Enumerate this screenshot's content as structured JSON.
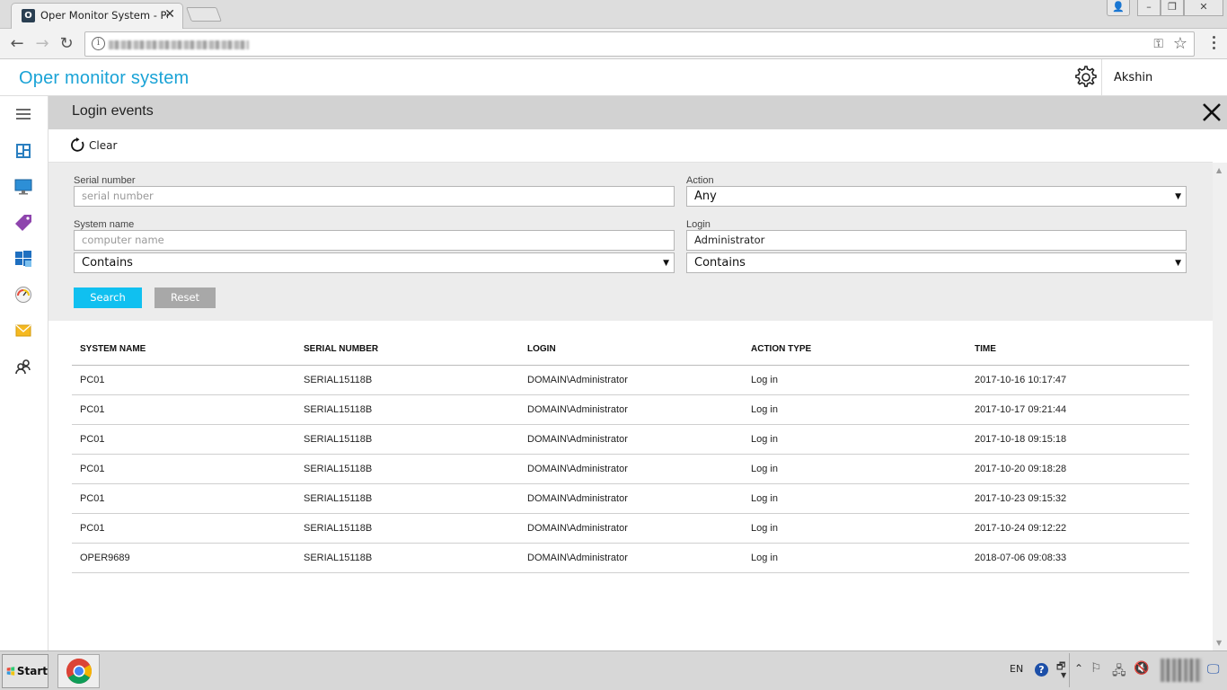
{
  "browser": {
    "tab_title": "Oper Monitor System - Port",
    "favicon_letter": "O"
  },
  "app": {
    "title": "Oper monitor system",
    "user": "Akshin Mustafayev",
    "accent": "#1aa3d6"
  },
  "sidebar": {
    "items": [
      {
        "icon": "hamburger-menu-icon"
      },
      {
        "icon": "dashboard-icon"
      },
      {
        "icon": "monitor-icon"
      },
      {
        "icon": "tag-icon"
      },
      {
        "icon": "windows-icon"
      },
      {
        "icon": "gauge-icon"
      },
      {
        "icon": "mail-icon"
      },
      {
        "icon": "users-icon"
      }
    ]
  },
  "panel": {
    "title": "Login events",
    "clear_label": "Clear"
  },
  "filters": {
    "serial_label": "Serial number",
    "serial_placeholder": "serial number",
    "action_label": "Action",
    "action_value": "Any",
    "system_label": "System name",
    "system_placeholder": "computer name",
    "system_match": "Contains",
    "login_label": "Login",
    "login_value": "Administrator",
    "login_match": "Contains",
    "search_label": "Search",
    "reset_label": "Reset",
    "search_color": "#10c0f0"
  },
  "table": {
    "headers": [
      "SYSTEM NAME",
      "SERIAL NUMBER",
      "LOGIN",
      "ACTION TYPE",
      "TIME"
    ],
    "rows": [
      [
        "PC01",
        "SERIAL15118B",
        "DOMAIN\\Administrator",
        "Log in",
        "2017-10-16 10:17:47"
      ],
      [
        "PC01",
        "SERIAL15118B",
        "DOMAIN\\Administrator",
        "Log in",
        "2017-10-17 09:21:44"
      ],
      [
        "PC01",
        "SERIAL15118B",
        "DOMAIN\\Administrator",
        "Log in",
        "2017-10-18 09:15:18"
      ],
      [
        "PC01",
        "SERIAL15118B",
        "DOMAIN\\Administrator",
        "Log in",
        "2017-10-20 09:18:28"
      ],
      [
        "PC01",
        "SERIAL15118B",
        "DOMAIN\\Administrator",
        "Log in",
        "2017-10-23 09:15:32"
      ],
      [
        "PC01",
        "SERIAL15118B",
        "DOMAIN\\Administrator",
        "Log in",
        "2017-10-24 09:12:22"
      ],
      [
        "OPER9689",
        "SERIAL15118B",
        "DOMAIN\\Administrator",
        "Log in",
        "2018-07-06 09:08:33"
      ]
    ]
  },
  "taskbar": {
    "start_label": "Start",
    "language": "EN",
    "help": "?"
  }
}
